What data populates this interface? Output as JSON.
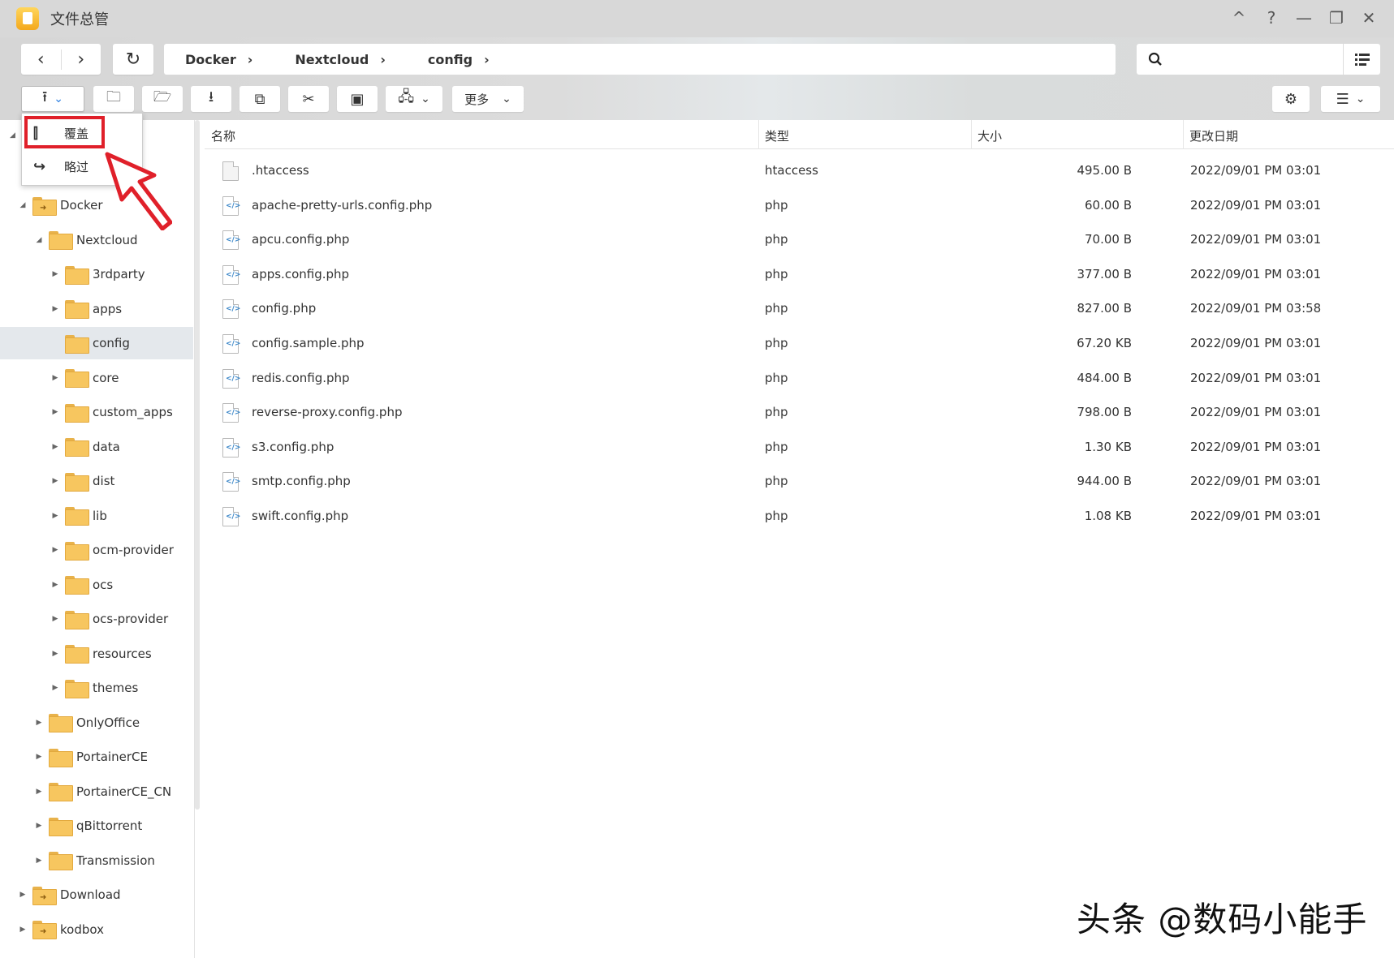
{
  "app": {
    "title": "文件总管"
  },
  "window_controls": [
    "^",
    "?",
    "—",
    "❐",
    "✕"
  ],
  "nav": {
    "back": "‹",
    "forward": "›",
    "refresh": "↻"
  },
  "breadcrumb": [
    "Docker",
    "Nextcloud",
    "config"
  ],
  "search": {
    "placeholder": ""
  },
  "toolbar": {
    "more_label": "更多"
  },
  "upload_menu": [
    {
      "label": "覆盖",
      "icon": "overwrite-icon"
    },
    {
      "label": "略过",
      "icon": "skip-icon"
    }
  ],
  "tree": [
    {
      "label": "Docker",
      "depth": 1,
      "expanded": true,
      "shared": true
    },
    {
      "label": "Nextcloud",
      "depth": 2,
      "expanded": true
    },
    {
      "label": "3rdparty",
      "depth": 3
    },
    {
      "label": "apps",
      "depth": 3
    },
    {
      "label": "config",
      "depth": 3,
      "selected": true,
      "leaf": true
    },
    {
      "label": "core",
      "depth": 3
    },
    {
      "label": "custom_apps",
      "depth": 3
    },
    {
      "label": "data",
      "depth": 3
    },
    {
      "label": "dist",
      "depth": 3
    },
    {
      "label": "lib",
      "depth": 3
    },
    {
      "label": "ocm-provider",
      "depth": 3
    },
    {
      "label": "ocs",
      "depth": 3
    },
    {
      "label": "ocs-provider",
      "depth": 3
    },
    {
      "label": "resources",
      "depth": 3
    },
    {
      "label": "themes",
      "depth": 3
    },
    {
      "label": "OnlyOffice",
      "depth": 2
    },
    {
      "label": "PortainerCE",
      "depth": 2
    },
    {
      "label": "PortainerCE_CN",
      "depth": 2
    },
    {
      "label": "qBittorrent",
      "depth": 2
    },
    {
      "label": "Transmission",
      "depth": 2
    },
    {
      "label": "Download",
      "depth": 1,
      "shared": true
    },
    {
      "label": "kodbox",
      "depth": 1,
      "shared": true
    }
  ],
  "columns": {
    "name": "名称",
    "type": "类型",
    "size": "大小",
    "modified": "更改日期"
  },
  "files": [
    {
      "name": ".htaccess",
      "type": "htaccess",
      "size": "495.00 B",
      "modified": "2022/09/01 PM 03:01",
      "icon": "plain"
    },
    {
      "name": "apache-pretty-urls.config.php",
      "type": "php",
      "size": "60.00 B",
      "modified": "2022/09/01 PM 03:01",
      "icon": "code"
    },
    {
      "name": "apcu.config.php",
      "type": "php",
      "size": "70.00 B",
      "modified": "2022/09/01 PM 03:01",
      "icon": "code"
    },
    {
      "name": "apps.config.php",
      "type": "php",
      "size": "377.00 B",
      "modified": "2022/09/01 PM 03:01",
      "icon": "code"
    },
    {
      "name": "config.php",
      "type": "php",
      "size": "827.00 B",
      "modified": "2022/09/01 PM 03:58",
      "icon": "code"
    },
    {
      "name": "config.sample.php",
      "type": "php",
      "size": "67.20 KB",
      "modified": "2022/09/01 PM 03:01",
      "icon": "code"
    },
    {
      "name": "redis.config.php",
      "type": "php",
      "size": "484.00 B",
      "modified": "2022/09/01 PM 03:01",
      "icon": "code"
    },
    {
      "name": "reverse-proxy.config.php",
      "type": "php",
      "size": "798.00 B",
      "modified": "2022/09/01 PM 03:01",
      "icon": "code"
    },
    {
      "name": "s3.config.php",
      "type": "php",
      "size": "1.30 KB",
      "modified": "2022/09/01 PM 03:01",
      "icon": "code"
    },
    {
      "name": "smtp.config.php",
      "type": "php",
      "size": "944.00 B",
      "modified": "2022/09/01 PM 03:01",
      "icon": "code"
    },
    {
      "name": "swift.config.php",
      "type": "php",
      "size": "1.08 KB",
      "modified": "2022/09/01 PM 03:01",
      "icon": "code"
    }
  ],
  "watermark": "头条 @数码小能手",
  "colors": {
    "highlight": "#e0202a",
    "folder": "#f7c65f",
    "selected_row": "#e4e8ec",
    "accent": "#2a7de1"
  }
}
